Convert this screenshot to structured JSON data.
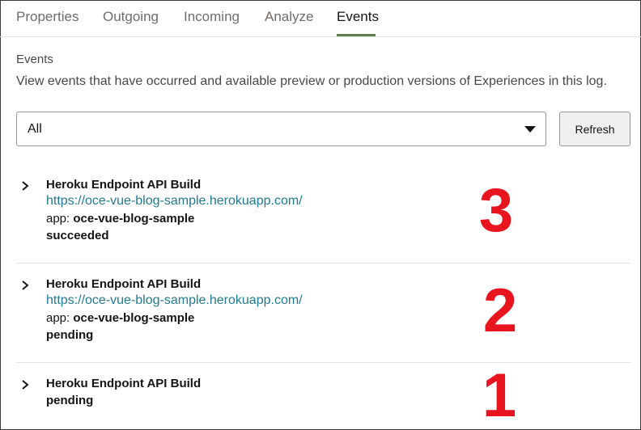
{
  "tabs": [
    {
      "label": "Properties"
    },
    {
      "label": "Outgoing"
    },
    {
      "label": "Incoming"
    },
    {
      "label": "Analyze"
    },
    {
      "label": "Events",
      "active": true
    }
  ],
  "section": {
    "title": "Events",
    "description": "View events that have occurred and available preview or production versions of Experiences in this log."
  },
  "filter": {
    "selected": "All"
  },
  "refresh_label": "Refresh",
  "events": [
    {
      "title": "Heroku Endpoint API Build",
      "url": "https://oce-vue-blog-sample.herokuapp.com/",
      "app_label": "app:",
      "app_name": "oce-vue-blog-sample",
      "status": "succeeded",
      "annotation": "3"
    },
    {
      "title": "Heroku Endpoint API Build",
      "url": "https://oce-vue-blog-sample.herokuapp.com/",
      "app_label": "app:",
      "app_name": "oce-vue-blog-sample",
      "status": "pending",
      "annotation": "2"
    },
    {
      "title": "Heroku Endpoint API Build",
      "status": "pending",
      "annotation": "1"
    }
  ],
  "colors": {
    "accent_underline": "#5f7d4f",
    "link": "#227a8f",
    "annotation_red": "#e8141e"
  },
  "icons": {
    "expand": "chevron-right-icon",
    "dropdown": "caret-down-icon"
  }
}
